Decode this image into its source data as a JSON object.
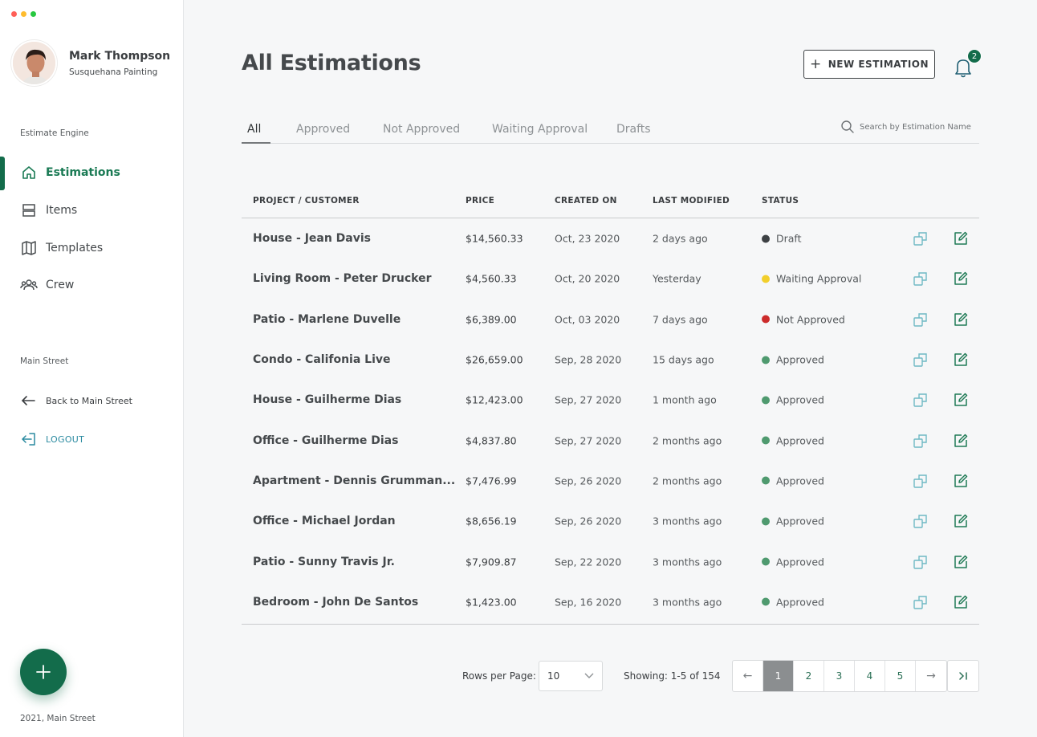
{
  "sidebar": {
    "user": {
      "name": "Mark Thompson",
      "company": "Susquehana Painting"
    },
    "section_engine": "Estimate Engine",
    "nav": [
      {
        "label": "Estimations",
        "icon": "home-icon",
        "active": true
      },
      {
        "label": "Items",
        "icon": "items-icon",
        "active": false
      },
      {
        "label": "Templates",
        "icon": "map-icon",
        "active": false
      },
      {
        "label": "Crew",
        "icon": "users-icon",
        "active": false
      }
    ],
    "section_main": "Main Street",
    "back_label": "Back to Main Street",
    "logout_label": "LOGOUT",
    "footer": "2021, Main Street"
  },
  "header": {
    "title": "All Estimations",
    "new_button": "NEW ESTIMATION",
    "notifications": "2"
  },
  "tabs": [
    "All",
    "Approved",
    "Not Approved",
    "Waiting Approval",
    "Drafts"
  ],
  "search": {
    "placeholder": "Search by Estimation Name"
  },
  "table": {
    "columns": [
      "PROJECT / CUSTOMER",
      "PRICE",
      "CREATED ON",
      "LAST MODIFIED",
      "STATUS"
    ],
    "rows": [
      {
        "project": "House - Jean Davis",
        "price": "$14,560.33",
        "created": "Oct, 23 2020",
        "modified": "2 days ago",
        "status": "Draft"
      },
      {
        "project": "Living Room - Peter Drucker",
        "price": "$4,560.33",
        "created": "Oct, 20 2020",
        "modified": "Yesterday",
        "status": "Waiting Approval"
      },
      {
        "project": "Patio - Marlene Duvelle",
        "price": "$6,389.00",
        "created": "Oct, 03 2020",
        "modified": "7 days ago",
        "status": "Not Approved"
      },
      {
        "project": "Condo - Califonia Live",
        "price": "$26,659.00",
        "created": "Sep, 28 2020",
        "modified": "15 days ago",
        "status": "Approved"
      },
      {
        "project": "House - Guilherme Dias",
        "price": "$12,423.00",
        "created": "Sep, 27 2020",
        "modified": "1 month ago",
        "status": "Approved"
      },
      {
        "project": "Office - Guilherme Dias",
        "price": "$4,837.80",
        "created": "Sep, 27 2020",
        "modified": "2 months ago",
        "status": "Approved"
      },
      {
        "project": "Apartment - Dennis Grumman...",
        "price": "$7,476.99",
        "created": "Sep, 26 2020",
        "modified": "2 months ago",
        "status": "Approved"
      },
      {
        "project": "Office - Michael Jordan",
        "price": "$8,656.19",
        "created": "Sep, 26 2020",
        "modified": "3 months ago",
        "status": "Approved"
      },
      {
        "project": "Patio - Sunny Travis Jr.",
        "price": "$7,909.87",
        "created": "Sep, 22 2020",
        "modified": "3 months ago",
        "status": "Approved"
      },
      {
        "project": "Bedroom - John De Santos",
        "price": "$1,423.00",
        "created": "Sep, 16 2020",
        "modified": "3 months ago",
        "status": "Approved"
      }
    ]
  },
  "status_colors": {
    "Draft": "#3d4144",
    "Waiting Approval": "#f2cf2c",
    "Not Approved": "#cc2b2b",
    "Approved": "#4f9a6f"
  },
  "pagination": {
    "rows_per_page_label": "Rows per Page:",
    "rows_per_page": "10",
    "showing": "Showing: 1-5 of 154",
    "prev": "←",
    "next": "→",
    "pages": [
      "1",
      "2",
      "3",
      "4",
      "5"
    ],
    "current_page": "1"
  },
  "colors": {
    "accent": "#136c4b",
    "accent_text": "#1a7a54",
    "logout": "#2a8aa0"
  }
}
